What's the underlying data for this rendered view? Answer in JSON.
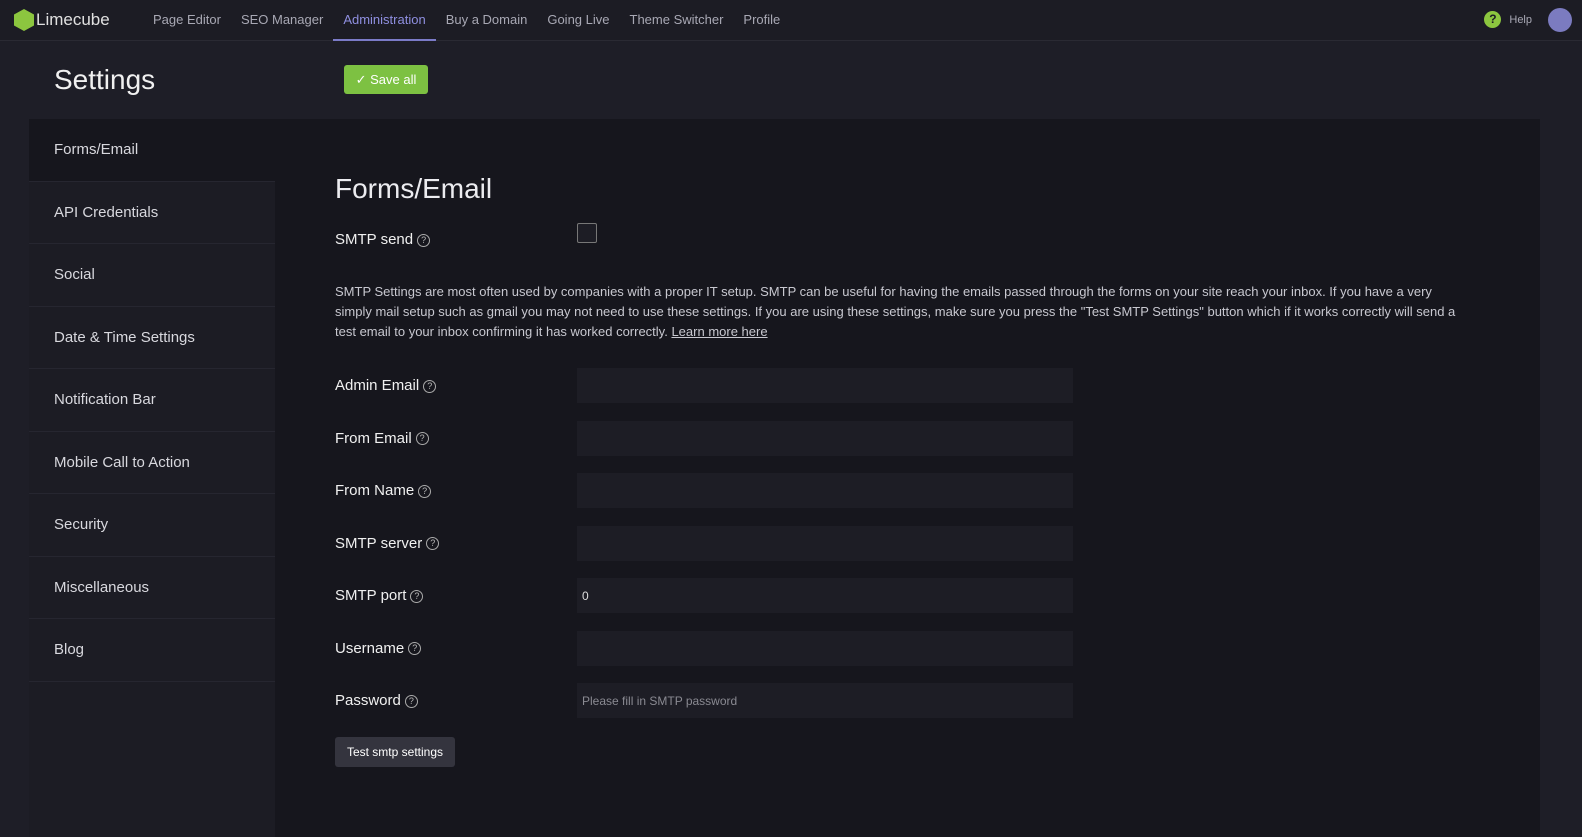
{
  "app": {
    "logo": "Limecube",
    "nav": [
      "Page Editor",
      "SEO Manager",
      "Administration",
      "Buy a Domain",
      "Going Live",
      "Theme Switcher",
      "Profile"
    ],
    "active_nav": "Administration",
    "help": "Help"
  },
  "header": {
    "title": "Settings",
    "save_label": "Save all"
  },
  "sidebar": {
    "items": [
      "Forms/Email",
      "API Credentials",
      "Social",
      "Date & Time Settings",
      "Notification Bar",
      "Mobile Call to Action",
      "Security",
      "Miscellaneous",
      "Blog"
    ]
  },
  "form": {
    "title": "Forms/Email",
    "smtp_send": "SMTP send",
    "smtp_send_checked": false,
    "description": "SMTP Settings are most often used by companies with a proper IT setup. SMTP can be useful for having the emails passed through the forms on your site reach your inbox. If you have a very simply mail setup such as gmail you may not need to use these settings. If you are using these settings, make sure you press the \"Test SMTP Settings\" button which if it works correctly will send a test email to your inbox confirming it has worked correctly. ",
    "learn_more": "Learn more here",
    "fields": [
      {
        "label": "Admin Email",
        "value": "",
        "placeholder": ""
      },
      {
        "label": "From Email",
        "value": "",
        "placeholder": ""
      },
      {
        "label": "From Name",
        "value": "",
        "placeholder": ""
      },
      {
        "label": "SMTP server",
        "value": "",
        "placeholder": ""
      },
      {
        "label": "SMTP port",
        "value": "0",
        "placeholder": ""
      },
      {
        "label": "Username",
        "value": "",
        "placeholder": ""
      },
      {
        "label": "Password",
        "value": "",
        "placeholder": "Please fill in SMTP password"
      }
    ],
    "test_label": "Test smtp settings"
  },
  "colors": {
    "accent": "#8cc63f",
    "nav_active": "#8f8fe0"
  }
}
